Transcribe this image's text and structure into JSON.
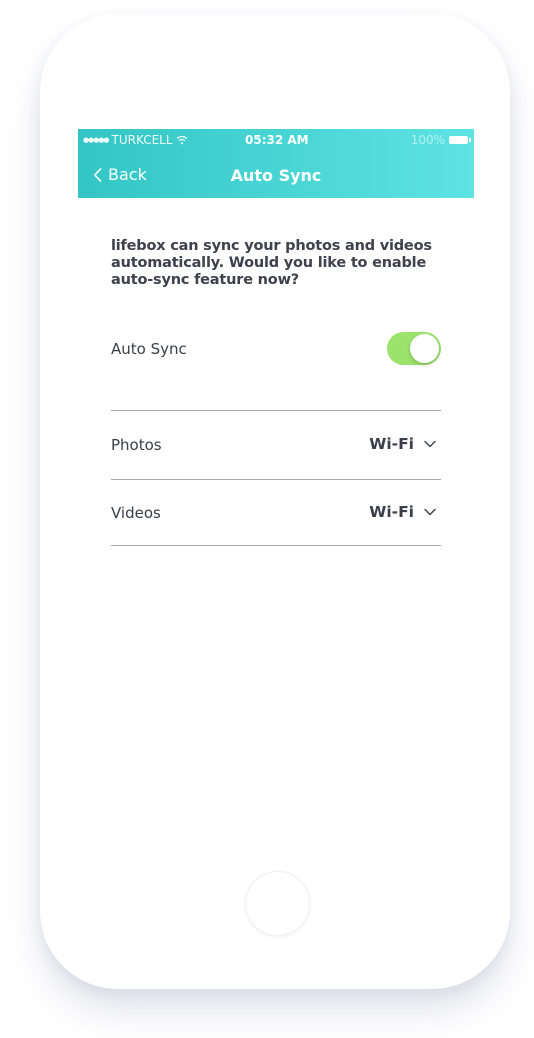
{
  "status_bar": {
    "carrier": "TURKCELL",
    "time": "05:32 AM",
    "battery": "100%"
  },
  "nav": {
    "back_label": "Back",
    "title": "Auto Sync"
  },
  "intro_text": "lifebox can sync your photos and videos automatically. Would you like to enable auto-sync feature now?",
  "auto_sync": {
    "label": "Auto Sync",
    "enabled": true
  },
  "settings": [
    {
      "label": "Photos",
      "value": "Wi-Fi"
    },
    {
      "label": "Videos",
      "value": "Wi-Fi"
    }
  ],
  "colors": {
    "header_start": "#33c5c5",
    "header_end": "#5ee3e3",
    "toggle_on": "#9be36b",
    "text": "#3b3d48"
  },
  "icons": {
    "back": "chevron-left-icon",
    "dropdown": "chevron-down-icon",
    "wifi": "wifi-icon",
    "battery": "battery-icon"
  }
}
